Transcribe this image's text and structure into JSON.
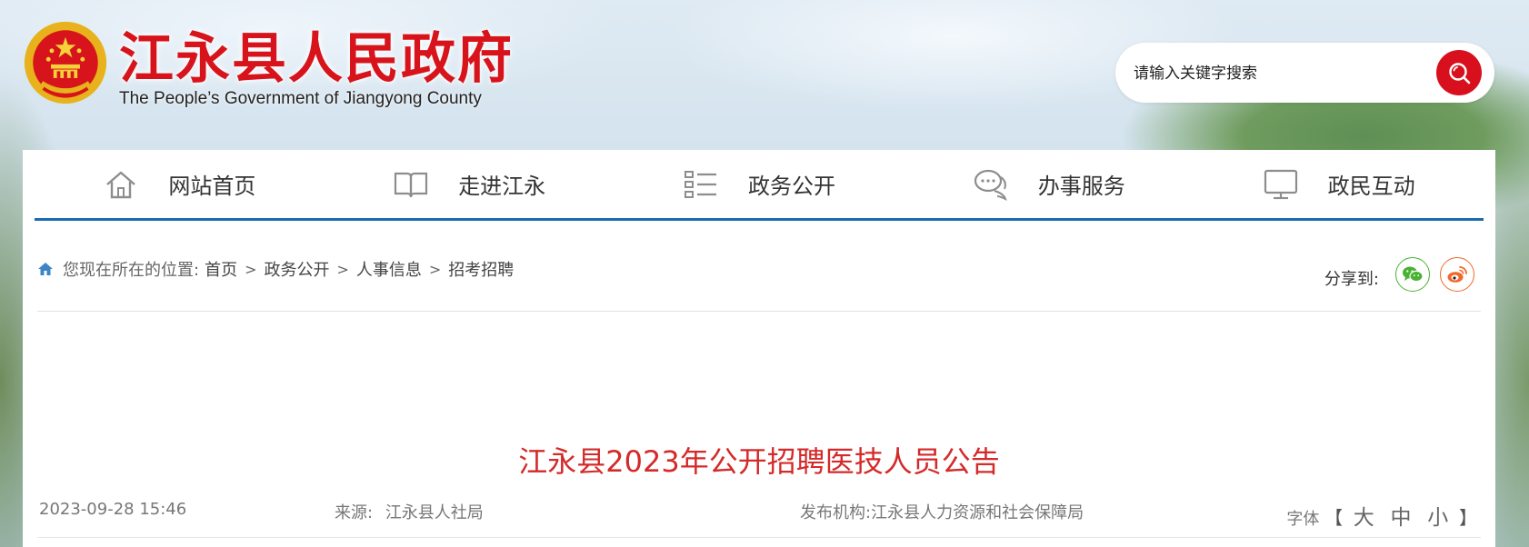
{
  "header": {
    "title": "江永县人民政府",
    "subtitle": "The People’s Government of Jiangyong County",
    "search": {
      "placeholder": "请输入关键字搜索"
    },
    "emblem_icon": "national-emblem-icon"
  },
  "nav": {
    "items": [
      {
        "label": "网站首页",
        "icon": "home-icon"
      },
      {
        "label": "走进江永",
        "icon": "book-icon"
      },
      {
        "label": "政务公开",
        "icon": "list-icon"
      },
      {
        "label": "办事服务",
        "icon": "chat-icon"
      },
      {
        "label": "政民互动",
        "icon": "monitor-icon"
      }
    ]
  },
  "breadcrumb": {
    "prefix": "您现在所在的位置:",
    "items": [
      "首页",
      "政务公开",
      "人事信息",
      "招考招聘"
    ],
    "separator": ">"
  },
  "share": {
    "label": "分享到:",
    "wechat_icon": "wechat-icon",
    "weibo_icon": "weibo-icon"
  },
  "article": {
    "title": "江永县2023年公开招聘医技人员公告",
    "date": "2023-09-28 15:46",
    "source_label": "来源:",
    "source": "江永县人社局",
    "org_label": "发布机构:",
    "org": "江永县人力资源和社会保障局",
    "font_label": "字体",
    "font_sizes": [
      "大",
      "中",
      "小"
    ],
    "bracket_open": "【",
    "bracket_close": "】"
  },
  "colors": {
    "brand_red": "#d7141b",
    "nav_blue": "#1a6bb1",
    "title_red": "#d42a2a",
    "wechat_green": "#49b233",
    "weibo_orange": "#f0692b"
  }
}
